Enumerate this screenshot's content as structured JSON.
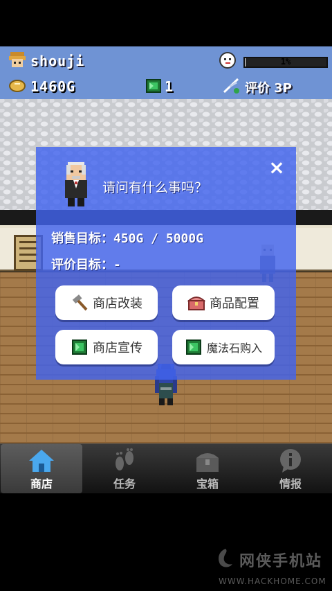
{
  "hud": {
    "player_name": "shouji",
    "money": "1460G",
    "gems": "1",
    "progress_label": "1%",
    "progress_value": 0.01,
    "rating": "评价 3P"
  },
  "dialog": {
    "greeting": "请问有什么事吗？",
    "close_label": "×",
    "sales_label": "销售目标：",
    "sales_value": "450G / 5000G",
    "rating_label": "评价目标：",
    "rating_value": "-",
    "buttons": [
      {
        "label": "商店改装",
        "icon": "hammer-icon"
      },
      {
        "label": "商品配置",
        "icon": "treasure-chest-icon"
      },
      {
        "label": "商店宣传",
        "icon": "green-gem-icon"
      },
      {
        "label": "魔法石购入",
        "icon": "green-gem-icon"
      }
    ]
  },
  "tabs": [
    {
      "label": "商店",
      "icon": "house-icon",
      "active": true
    },
    {
      "label": "任务",
      "icon": "footprints-icon",
      "active": false
    },
    {
      "label": "宝箱",
      "icon": "treasure-box-icon",
      "active": false
    },
    {
      "label": "情报",
      "icon": "info-bubble-icon",
      "active": false
    }
  ],
  "watermark": {
    "title": "网侠手机站",
    "url": "WWW.HACKHOME.COM"
  },
  "colors": {
    "hud_bg": "#6f93d4",
    "dialog_bg": "#4264ee",
    "gem_green": "#2fa34a"
  }
}
